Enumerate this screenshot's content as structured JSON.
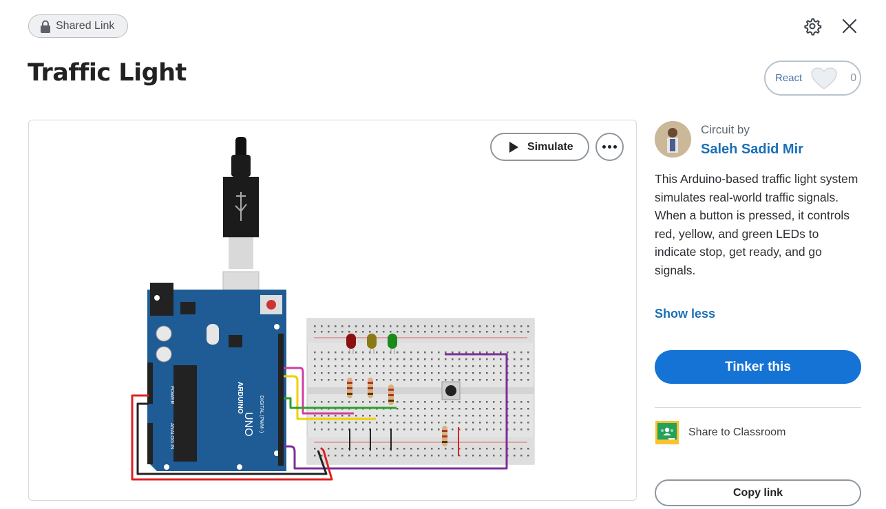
{
  "header": {
    "shared_label": "Shared Link",
    "title": "Traffic Light",
    "react_label": "React",
    "react_count": "0"
  },
  "canvas": {
    "simulate_label": "Simulate"
  },
  "author": {
    "circuit_by": "Circuit by",
    "name": "Saleh Sadid Mir"
  },
  "description": "This Arduino-based traffic light system simulates real-world traffic signals. When a button is pressed, it controls red, yellow, and green LEDs to indicate stop, get ready, and go signals.",
  "actions": {
    "show_less": "Show less",
    "tinker": "Tinker this",
    "share_classroom": "Share to Classroom",
    "copy_link": "Copy link"
  },
  "board_labels": {
    "brand": "ARDUINO",
    "model": "UNO",
    "digital": "DIGITAL (PWM~)",
    "analog": "ANALOG IN",
    "power": "POWER"
  },
  "colors": {
    "accent": "#1673d6",
    "link": "#1a6fb8",
    "board": "#1f5b94",
    "wire_red": "#e02020",
    "wire_yellow": "#f0d000",
    "wire_green": "#2aa02a",
    "wire_pink": "#d23ea0",
    "wire_purple": "#7b2f9a"
  }
}
